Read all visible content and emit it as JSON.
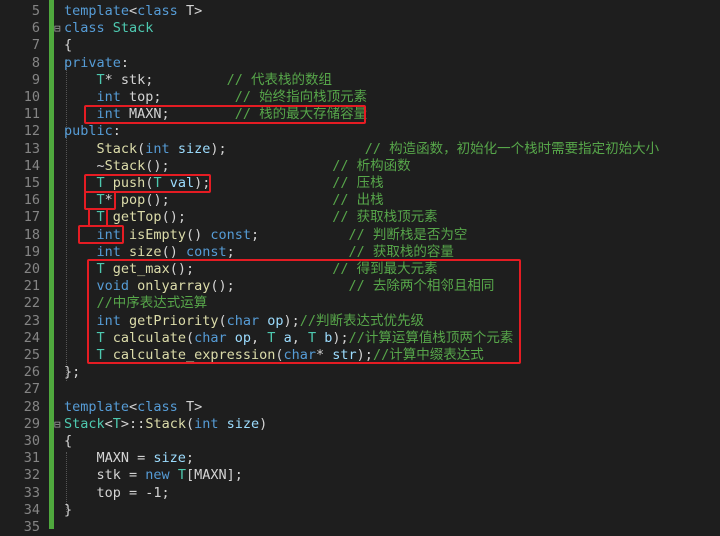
{
  "editor": {
    "lines": [
      {
        "num": "5",
        "fold": "",
        "tokens": [
          {
            "t": "template",
            "c": "kw"
          },
          {
            "t": "<",
            "c": "id"
          },
          {
            "t": "class",
            "c": "kw"
          },
          {
            "t": " T>",
            "c": "id"
          }
        ]
      },
      {
        "num": "6",
        "fold": "⊟",
        "tokens": [
          {
            "t": "class",
            "c": "kw"
          },
          {
            "t": " ",
            "c": "id"
          },
          {
            "t": "Stack",
            "c": "ty"
          }
        ]
      },
      {
        "num": "7",
        "fold": "",
        "tokens": [
          {
            "t": "{",
            "c": "id"
          }
        ]
      },
      {
        "num": "8",
        "fold": "",
        "tokens": [
          {
            "t": "private",
            "c": "kw"
          },
          {
            "t": ":",
            "c": "id"
          }
        ]
      },
      {
        "num": "9",
        "fold": "",
        "tokens": [
          {
            "t": "    ",
            "c": "id"
          },
          {
            "t": "T",
            "c": "ty"
          },
          {
            "t": "* stk;         ",
            "c": "id"
          },
          {
            "t": "// 代表栈的数组",
            "c": "cm"
          }
        ]
      },
      {
        "num": "10",
        "fold": "",
        "tokens": [
          {
            "t": "    ",
            "c": "id"
          },
          {
            "t": "int",
            "c": "kw"
          },
          {
            "t": " top;         ",
            "c": "id"
          },
          {
            "t": "// 始终指向栈顶元素",
            "c": "cm"
          }
        ]
      },
      {
        "num": "11",
        "fold": "",
        "tokens": [
          {
            "t": "    ",
            "c": "id"
          },
          {
            "t": "int",
            "c": "kw"
          },
          {
            "t": " MAXN;        ",
            "c": "id"
          },
          {
            "t": "// 栈的最大存储容量",
            "c": "cm"
          }
        ]
      },
      {
        "num": "12",
        "fold": "",
        "tokens": [
          {
            "t": "public",
            "c": "kw"
          },
          {
            "t": ":",
            "c": "id"
          }
        ]
      },
      {
        "num": "13",
        "fold": "",
        "tokens": [
          {
            "t": "    ",
            "c": "id"
          },
          {
            "t": "Stack",
            "c": "fn"
          },
          {
            "t": "(",
            "c": "id"
          },
          {
            "t": "int",
            "c": "kw"
          },
          {
            "t": " ",
            "c": "id"
          },
          {
            "t": "size",
            "c": "pr"
          },
          {
            "t": ");                 ",
            "c": "id"
          },
          {
            "t": "// 构造函数，初始化一个栈时需要指定初始大小",
            "c": "cm"
          }
        ]
      },
      {
        "num": "14",
        "fold": "",
        "tokens": [
          {
            "t": "    ~",
            "c": "id"
          },
          {
            "t": "Stack",
            "c": "fn"
          },
          {
            "t": "();                    ",
            "c": "id"
          },
          {
            "t": "// 析构函数",
            "c": "cm"
          }
        ]
      },
      {
        "num": "15",
        "fold": "",
        "tokens": [
          {
            "t": "    ",
            "c": "id"
          },
          {
            "t": "T",
            "c": "ty"
          },
          {
            "t": " ",
            "c": "id"
          },
          {
            "t": "push",
            "c": "fn"
          },
          {
            "t": "(",
            "c": "id"
          },
          {
            "t": "T",
            "c": "ty"
          },
          {
            "t": " ",
            "c": "id"
          },
          {
            "t": "val",
            "c": "pr"
          },
          {
            "t": ");               ",
            "c": "id"
          },
          {
            "t": "// 压栈",
            "c": "cm"
          }
        ]
      },
      {
        "num": "16",
        "fold": "",
        "tokens": [
          {
            "t": "    ",
            "c": "id"
          },
          {
            "t": "T",
            "c": "ty"
          },
          {
            "t": "* ",
            "c": "id"
          },
          {
            "t": "pop",
            "c": "fn"
          },
          {
            "t": "();                    ",
            "c": "id"
          },
          {
            "t": "// 出栈",
            "c": "cm"
          }
        ]
      },
      {
        "num": "17",
        "fold": "",
        "tokens": [
          {
            "t": "    ",
            "c": "id"
          },
          {
            "t": "T",
            "c": "ty"
          },
          {
            "t": " ",
            "c": "id"
          },
          {
            "t": "getTop",
            "c": "fn"
          },
          {
            "t": "();                  ",
            "c": "id"
          },
          {
            "t": "// 获取栈顶元素",
            "c": "cm"
          }
        ]
      },
      {
        "num": "18",
        "fold": "",
        "tokens": [
          {
            "t": "    ",
            "c": "id"
          },
          {
            "t": "int",
            "c": "kw"
          },
          {
            "t": " ",
            "c": "id"
          },
          {
            "t": "isEmpty",
            "c": "fn"
          },
          {
            "t": "() ",
            "c": "id"
          },
          {
            "t": "const",
            "c": "kw"
          },
          {
            "t": ";           ",
            "c": "id"
          },
          {
            "t": "// 判断栈是否为空",
            "c": "cm"
          }
        ]
      },
      {
        "num": "19",
        "fold": "",
        "tokens": [
          {
            "t": "    ",
            "c": "id"
          },
          {
            "t": "int",
            "c": "kw"
          },
          {
            "t": " ",
            "c": "id"
          },
          {
            "t": "size",
            "c": "fn"
          },
          {
            "t": "() ",
            "c": "id"
          },
          {
            "t": "const",
            "c": "kw"
          },
          {
            "t": ";              ",
            "c": "id"
          },
          {
            "t": "// 获取栈的容量",
            "c": "cm"
          }
        ]
      },
      {
        "num": "20",
        "fold": "",
        "tokens": [
          {
            "t": "    ",
            "c": "id"
          },
          {
            "t": "T",
            "c": "ty"
          },
          {
            "t": " ",
            "c": "id"
          },
          {
            "t": "get_max",
            "c": "fn"
          },
          {
            "t": "();                 ",
            "c": "id"
          },
          {
            "t": "// 得到最大元素",
            "c": "cm"
          }
        ]
      },
      {
        "num": "21",
        "fold": "",
        "tokens": [
          {
            "t": "    ",
            "c": "id"
          },
          {
            "t": "void",
            "c": "kw"
          },
          {
            "t": " ",
            "c": "id"
          },
          {
            "t": "onlyarray",
            "c": "fn"
          },
          {
            "t": "();              ",
            "c": "id"
          },
          {
            "t": "// 去除两个相邻且相同",
            "c": "cm"
          }
        ]
      },
      {
        "num": "22",
        "fold": "",
        "tokens": [
          {
            "t": "    ",
            "c": "id"
          },
          {
            "t": "//中序表达式运算",
            "c": "cm"
          }
        ]
      },
      {
        "num": "23",
        "fold": "",
        "tokens": [
          {
            "t": "    ",
            "c": "id"
          },
          {
            "t": "int",
            "c": "kw"
          },
          {
            "t": " ",
            "c": "id"
          },
          {
            "t": "getPriority",
            "c": "fn"
          },
          {
            "t": "(",
            "c": "id"
          },
          {
            "t": "char",
            "c": "kw"
          },
          {
            "t": " ",
            "c": "id"
          },
          {
            "t": "op",
            "c": "pr"
          },
          {
            "t": ");",
            "c": "id"
          },
          {
            "t": "//判断表达式优先级",
            "c": "cm"
          }
        ]
      },
      {
        "num": "24",
        "fold": "",
        "tokens": [
          {
            "t": "    ",
            "c": "id"
          },
          {
            "t": "T",
            "c": "ty"
          },
          {
            "t": " ",
            "c": "id"
          },
          {
            "t": "calculate",
            "c": "fn"
          },
          {
            "t": "(",
            "c": "id"
          },
          {
            "t": "char",
            "c": "kw"
          },
          {
            "t": " ",
            "c": "id"
          },
          {
            "t": "op",
            "c": "pr"
          },
          {
            "t": ", ",
            "c": "id"
          },
          {
            "t": "T",
            "c": "ty"
          },
          {
            "t": " ",
            "c": "id"
          },
          {
            "t": "a",
            "c": "pr"
          },
          {
            "t": ", ",
            "c": "id"
          },
          {
            "t": "T",
            "c": "ty"
          },
          {
            "t": " ",
            "c": "id"
          },
          {
            "t": "b",
            "c": "pr"
          },
          {
            "t": ");",
            "c": "id"
          },
          {
            "t": "//计算运算值栈顶两个元素",
            "c": "cm"
          }
        ]
      },
      {
        "num": "25",
        "fold": "",
        "tokens": [
          {
            "t": "    ",
            "c": "id"
          },
          {
            "t": "T",
            "c": "ty"
          },
          {
            "t": " ",
            "c": "id"
          },
          {
            "t": "calculate_expression",
            "c": "fn"
          },
          {
            "t": "(",
            "c": "id"
          },
          {
            "t": "char",
            "c": "kw"
          },
          {
            "t": "* ",
            "c": "id"
          },
          {
            "t": "str",
            "c": "pr"
          },
          {
            "t": ");",
            "c": "id"
          },
          {
            "t": "//计算中缀表达式",
            "c": "cm"
          }
        ]
      },
      {
        "num": "26",
        "fold": "",
        "tokens": [
          {
            "t": "};",
            "c": "id"
          }
        ]
      },
      {
        "num": "27",
        "fold": "",
        "tokens": []
      },
      {
        "num": "28",
        "fold": "",
        "tokens": [
          {
            "t": "template",
            "c": "kw"
          },
          {
            "t": "<",
            "c": "id"
          },
          {
            "t": "class",
            "c": "kw"
          },
          {
            "t": " T>",
            "c": "id"
          }
        ]
      },
      {
        "num": "29",
        "fold": "⊟",
        "tokens": [
          {
            "t": "Stack",
            "c": "ty"
          },
          {
            "t": "<",
            "c": "id"
          },
          {
            "t": "T",
            "c": "ty"
          },
          {
            "t": ">::",
            "c": "id"
          },
          {
            "t": "Stack",
            "c": "fn"
          },
          {
            "t": "(",
            "c": "id"
          },
          {
            "t": "int",
            "c": "kw"
          },
          {
            "t": " ",
            "c": "id"
          },
          {
            "t": "size",
            "c": "pr"
          },
          {
            "t": ")",
            "c": "id"
          }
        ]
      },
      {
        "num": "30",
        "fold": "",
        "tokens": [
          {
            "t": "{",
            "c": "id"
          }
        ]
      },
      {
        "num": "31",
        "fold": "",
        "tokens": [
          {
            "t": "    MAXN = ",
            "c": "id"
          },
          {
            "t": "size",
            "c": "pr"
          },
          {
            "t": ";",
            "c": "id"
          }
        ]
      },
      {
        "num": "32",
        "fold": "",
        "tokens": [
          {
            "t": "    stk = ",
            "c": "id"
          },
          {
            "t": "new",
            "c": "kw"
          },
          {
            "t": " ",
            "c": "id"
          },
          {
            "t": "T",
            "c": "ty"
          },
          {
            "t": "[MAXN];",
            "c": "id"
          }
        ]
      },
      {
        "num": "33",
        "fold": "",
        "tokens": [
          {
            "t": "    top = -1;",
            "c": "id"
          }
        ]
      },
      {
        "num": "34",
        "fold": "",
        "tokens": [
          {
            "t": "}",
            "c": "id"
          }
        ]
      },
      {
        "num": "35",
        "fold": "",
        "tokens": []
      }
    ]
  },
  "colors": {
    "background": "#1e1e1e",
    "keyword": "#569cd6",
    "type": "#4ec9b0",
    "function": "#dcdcaa",
    "param": "#9cdcfe",
    "comment": "#57a64a",
    "highlight": "#e51c23",
    "gutter_bar": "#4fa83d"
  }
}
